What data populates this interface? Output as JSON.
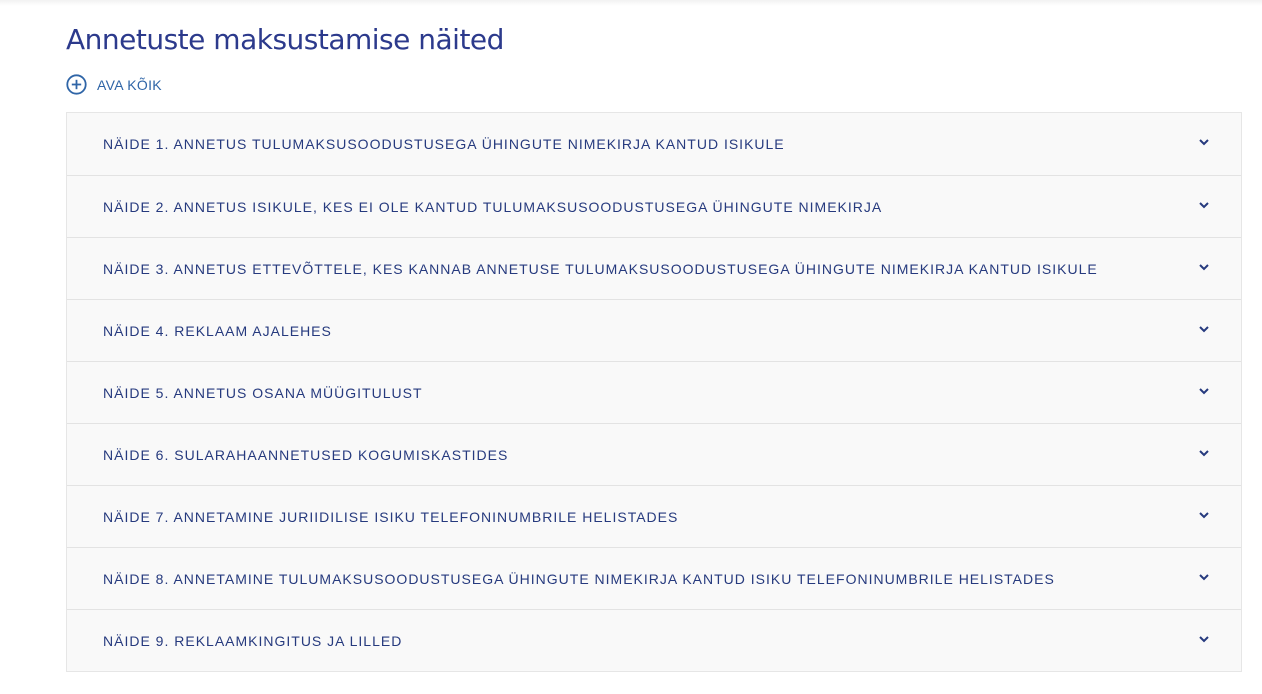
{
  "page": {
    "title": "Annetuste maksustamise näited"
  },
  "open_all": {
    "label": "AVA KÕIK",
    "icon": "plus-circle-icon"
  },
  "accordion": {
    "items": [
      {
        "label": "NÄIDE 1. ANNETUS TULUMAKSUSOODUSTUSEGA ÜHINGUTE NIMEKIRJA KANTUD ISIKULE"
      },
      {
        "label": "NÄIDE 2. ANNETUS ISIKULE, KES EI OLE KANTUD TULUMAKSUSOODUSTUSEGA ÜHINGUTE NIMEKIRJA"
      },
      {
        "label": "NÄIDE 3. ANNETUS ETTEVÕTTELE, KES KANNAB ANNETUSE TULUMAKSUSOODUSTUSEGA ÜHINGUTE NIMEKIRJA KANTUD ISIKULE"
      },
      {
        "label": "NÄIDE 4. REKLAAM AJALEHES"
      },
      {
        "label": "NÄIDE 5. ANNETUS OSANA MÜÜGITULUST"
      },
      {
        "label": "NÄIDE 6. SULARAHAANNETUSED KOGUMISKASTIDES"
      },
      {
        "label": "NÄIDE 7. ANNETAMINE JURIIDILISE ISIKU TELEFONINUMBRILE HELISTADES"
      },
      {
        "label": "NÄIDE 8. ANNETAMINE TULUMAKSUSOODUSTUSEGA ÜHINGUTE NIMEKIRJA KANTUD ISIKU TELEFONINUMBRILE HELISTADES"
      },
      {
        "label": "NÄIDE 9. REKLAAMKINGITUS JA LILLED"
      }
    ],
    "chevron_icon": "chevron-down-icon"
  },
  "colors": {
    "title": "#2c3a8c",
    "link": "#2f65a7",
    "item_text": "#263a7e",
    "item_bg": "#f9f9f9",
    "border": "#e3e3e3"
  }
}
